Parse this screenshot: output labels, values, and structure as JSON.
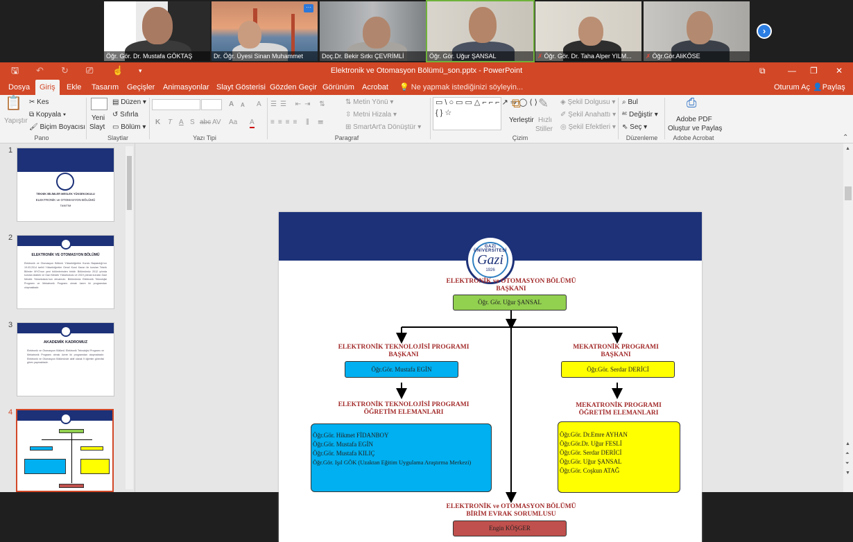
{
  "meeting": {
    "participants": [
      {
        "name": "Öğr. Gör. Dr. Mustafa GÖKTAŞ",
        "muted": false
      },
      {
        "name": "Dr. Öğr. Üyesi Sinan Muhammet",
        "muted": false
      },
      {
        "name": "Doç.Dr. Bekir Sıtkı ÇEVRİMLİ",
        "muted": false
      },
      {
        "name": "Öğr. Gör. Uğur ŞANSAL",
        "muted": false
      },
      {
        "name": "Öğr. Gör. Dr. Taha Alper YILM...",
        "muted": true
      },
      {
        "name": "Öğr.Gör.AliKÖSE",
        "muted": true
      }
    ],
    "more_label": "···",
    "next_label": "›"
  },
  "app": {
    "window_title": "Elektronik ve Otomasyon Bölümü_son.pptx - PowerPoint",
    "qat": {
      "save": "🖫",
      "undo": "↶",
      "redo": "↻",
      "present": "⎚",
      "touch": "☝",
      "customize": "▾"
    },
    "window_controls": {
      "ribbon_display": "⧉",
      "minimize": "—",
      "restore": "❐",
      "close": "✕"
    },
    "tabs": [
      "Dosya",
      "Giriş",
      "Ekle",
      "Tasarım",
      "Geçişler",
      "Animasyonlar",
      "Slayt Gösterisi",
      "Gözden Geçir",
      "Görünüm",
      "Acrobat"
    ],
    "active_tab": "Giriş",
    "tell_me": "Ne yapmak istediğinizi söyleyin...",
    "sign_in": "Oturum Aç",
    "share": "Paylaş"
  },
  "ribbon": {
    "pano": {
      "paste": "Yapıştır",
      "cut": "Kes",
      "copy": "Kopyala",
      "format_painter": "Biçim Boyacısı",
      "label": "Pano"
    },
    "slaytlar": {
      "new_slide_1": "Yeni",
      "new_slide_2": "Slayt",
      "layout": "Düzen",
      "reset": "Sıfırla",
      "section": "Bölüm",
      "label": "Slaytlar"
    },
    "yazi_tipi": {
      "label": "Yazı Tipi",
      "bold": "K",
      "italic": "T",
      "underline": "A",
      "shadow": "S",
      "strike": "abc",
      "spacing": "AV",
      "case": "Aa",
      "color": "A",
      "grow": "A",
      "shrink": "A",
      "clear": "A"
    },
    "paragraf": {
      "label": "Paragraf",
      "text_direction": "Metin Yönü",
      "align_text": "Metni Hizala",
      "smartart": "SmartArt'a Dönüştür"
    },
    "cizim": {
      "label": "Çizim",
      "shapes_glyphs": "▭\\○▭▭△⌐⌐⌐↗⇒◯⟨⟩{}☆",
      "arrange": "Yerleştir",
      "quick_styles_1": "Hızlı",
      "quick_styles_2": "Stiller",
      "fill": "Şekil Dolgusu",
      "outline": "Şekil Anahattı",
      "effects": "Şekil Efektleri"
    },
    "duzenleme": {
      "label": "Düzenleme",
      "find": "Bul",
      "replace": "Değiştir",
      "select": "Seç"
    },
    "acrobat": {
      "label": "Adobe Acrobat",
      "create_1": "Adobe PDF",
      "create_2": "Oluştur ve Paylaş"
    }
  },
  "thumbnails": [
    {
      "num": "1",
      "title": "TEKNİK BİLİMLER MESLEK YÜKSEKOKULU",
      "subtitle": "ELEKTRONİK ve OTOMASYON BÖLÜMÜ",
      "sub2": "TANITIM"
    },
    {
      "num": "2",
      "title": "ELEKTRONİK VE OTOMASYON BÖLÜMÜ",
      "body": "Elektronik ve Otomasyon Bölümü Yükseköğretim Kurulu Başkanlığı'nın 19.03.2014 tarihli Yükseköğretim Genel Kurul Kararı ile kurulan Teknik Bilimler MYO'nun yeni bölümlerinden biridir. Bölümümüz 2012 yılında kurulan Atatürk ve Gazi Meslek Yüksekokulu ve 2019 yılında kurulan Gazi Meslek Yüksekokulu'nun devamıdır. Bölümümüz Elektronik Teknolojisi Programı ve Mekatronik Programı olmak üzere iki programdan oluşmaktadır."
    },
    {
      "num": "3",
      "title": "AKADEMİK KADROMUZ",
      "body": "Elektronik ve Otomasyon Bölümü Elektronik Teknolojisi Programı ve Mekatronik Programı olmak üzere iki programdan oluşmaktadır. Elektronik ve Otomasyon Bölümünde aktif olarak 9 öğretim görevlisi görev yapmaktadır."
    },
    {
      "num": "4"
    }
  ],
  "slide": {
    "logo_text": "GAZİ ÜNİVERSİTESİ",
    "logo_letter": "Gazi",
    "logo_year": "1926",
    "head_title_1": "ELEKTRONİK ve OTOMASYON BÖLÜMÜ",
    "head_title_2": "BAŞKANI",
    "head_name": "Öğr. Gör. Uğur ŞANSAL",
    "left_title_1": "ELEKTRONİK TEKNOLOJİSİ PROGRAMI",
    "left_title_2": "BAŞKANI",
    "left_name": "Öğr.Gör. Mustafa EGİN",
    "left_staff_title_1": "ELEKTRONİK TEKNOLOJİSİ PROGRAMI",
    "left_staff_title_2": "ÖĞRETİM ELEMANLARI",
    "left_staff": [
      "Öğr.Gör.  Hikmet FİDANBOY",
      "Öğr.Gör.  Mustafa EGİN",
      "Öğr.Gör.  Mustafa KILIÇ",
      "Öğr.Gör.  Işıl GÖK (Uzaktan Eğitim Uygulama Araştırma Merkezi)"
    ],
    "right_title_1": "MEKATRONİK PROGRAMI",
    "right_title_2": "BAŞKANI",
    "right_name": "Öğr.Gör. Serdar DERİCİ",
    "right_staff_title_1": "MEKATRONİK PROGRAMI",
    "right_staff_title_2": "ÖĞRETİM ELEMANLARI",
    "right_staff": [
      "Öğr.Gör. Dr.Emre AYHAN",
      "Öğr.Gör.Dr. Uğur FESLİ",
      "Öğr.Gör. Serdar DERİCİ",
      "Öğr.Gör. Uğur ŞANSAL",
      "Öğr.Gör. Coşkun ATAĞ"
    ],
    "bottom_title_1": "ELEKTRONİK ve OTOMASYON BÖLÜMÜ",
    "bottom_title_2": "BİRİM EVRAK SORUMLUSU",
    "bottom_name": "Engin KÖŞGER"
  },
  "colors": {
    "accent": "#d24726",
    "slide_band": "#1c3178",
    "green_box": "#92d050",
    "blue_box": "#00b0f0",
    "yellow_box": "#ffff00",
    "red_box": "#c0504d",
    "title_red": "#a32b2b"
  }
}
